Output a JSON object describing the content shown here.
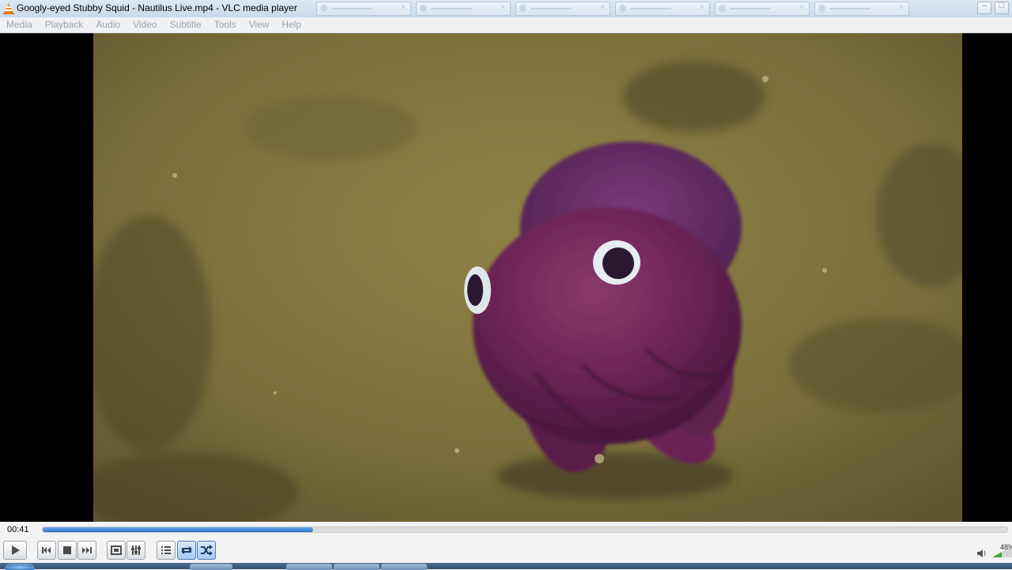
{
  "window": {
    "title": "Googly-eyed Stubby Squid - Nautilus Live.mp4 - VLC media player",
    "app_icon": "vlc-cone-icon"
  },
  "menu": [
    "Media",
    "Playback",
    "Audio",
    "Video",
    "Subtitle",
    "Tools",
    "View",
    "Help"
  ],
  "player": {
    "elapsed": "00:41",
    "progress": 0.28,
    "volume_label": "48%",
    "loop_active": true,
    "random_active": true
  },
  "icons": {
    "play": "play-icon",
    "previous": "previous-icon",
    "stop": "stop-icon",
    "next": "next-icon",
    "fullscreen": "fullscreen-icon",
    "extended": "extended-settings-icon",
    "playlist": "playlist-icon",
    "loop": "loop-icon",
    "random": "random-icon",
    "volume": "speaker-icon"
  },
  "colors": {
    "accent": "#2c6fcc",
    "video_bg": "#000000"
  }
}
